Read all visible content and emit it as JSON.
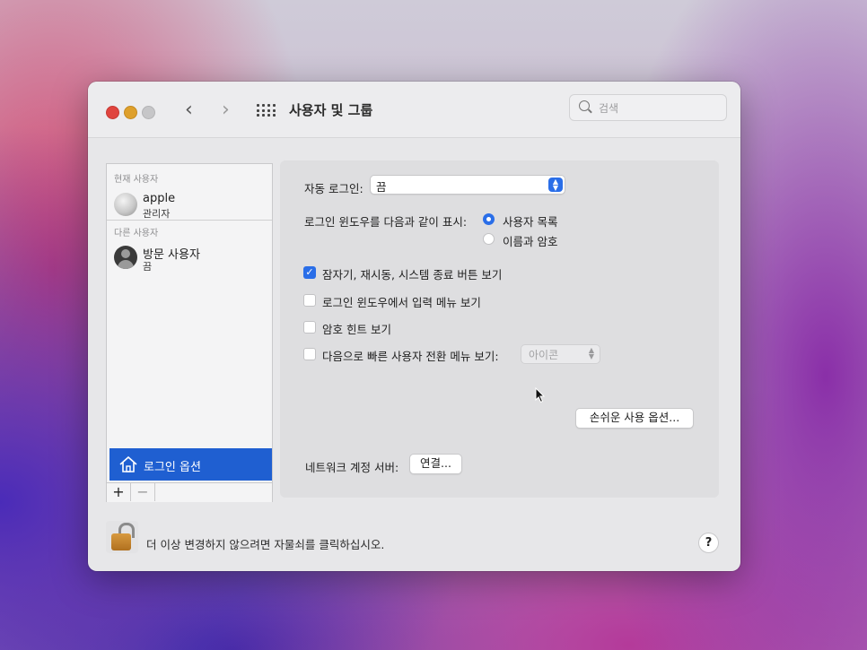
{
  "window": {
    "title": "사용자 및 그룹",
    "nav_back": "‹",
    "nav_forward": "›",
    "search_placeholder": "검색"
  },
  "sidebar": {
    "current_user_label": "현재 사용자",
    "current_user": {
      "name": "apple",
      "role": "관리자"
    },
    "other_users_label": "다른 사용자",
    "other_users": [
      {
        "name": "방문 사용자",
        "role": "끔"
      }
    ],
    "login_options_label": "로그인 옵션",
    "add_label": "+",
    "remove_label": "−"
  },
  "login_options": {
    "auto_login_label": "자동 로그인:",
    "auto_login_value": "끔",
    "display_label": "로그인 윈도우를 다음과 같이 표시:",
    "display_options": [
      {
        "label": "사용자 목록",
        "selected": true
      },
      {
        "label": "이름과 암호",
        "selected": false
      }
    ],
    "checkboxes": [
      {
        "label": "잠자기, 재시동, 시스템 종료 버튼 보기",
        "checked": true
      },
      {
        "label": "로그인 윈도우에서 입력 메뉴 보기",
        "checked": false
      },
      {
        "label": "암호 힌트 보기",
        "checked": false
      },
      {
        "label": "다음으로 빠른 사용자 전환 메뉴 보기:",
        "checked": false
      }
    ],
    "fast_switch_value": "아이콘",
    "accessibility_button": "손쉬운 사용 옵션...",
    "network_server_label": "네트워크 계정 서버:",
    "connect_button": "연결..."
  },
  "footer": {
    "lock_text": "더 이상 변경하지 않으려면 자물쇠를 클릭하십시오.",
    "help_label": "?"
  },
  "colors": {
    "accent": "#2a6ee8",
    "selection": "#1f5fd1",
    "close": "#e0443e",
    "minimize": "#dea02c",
    "zoom_disabled": "#c6c6c8"
  }
}
